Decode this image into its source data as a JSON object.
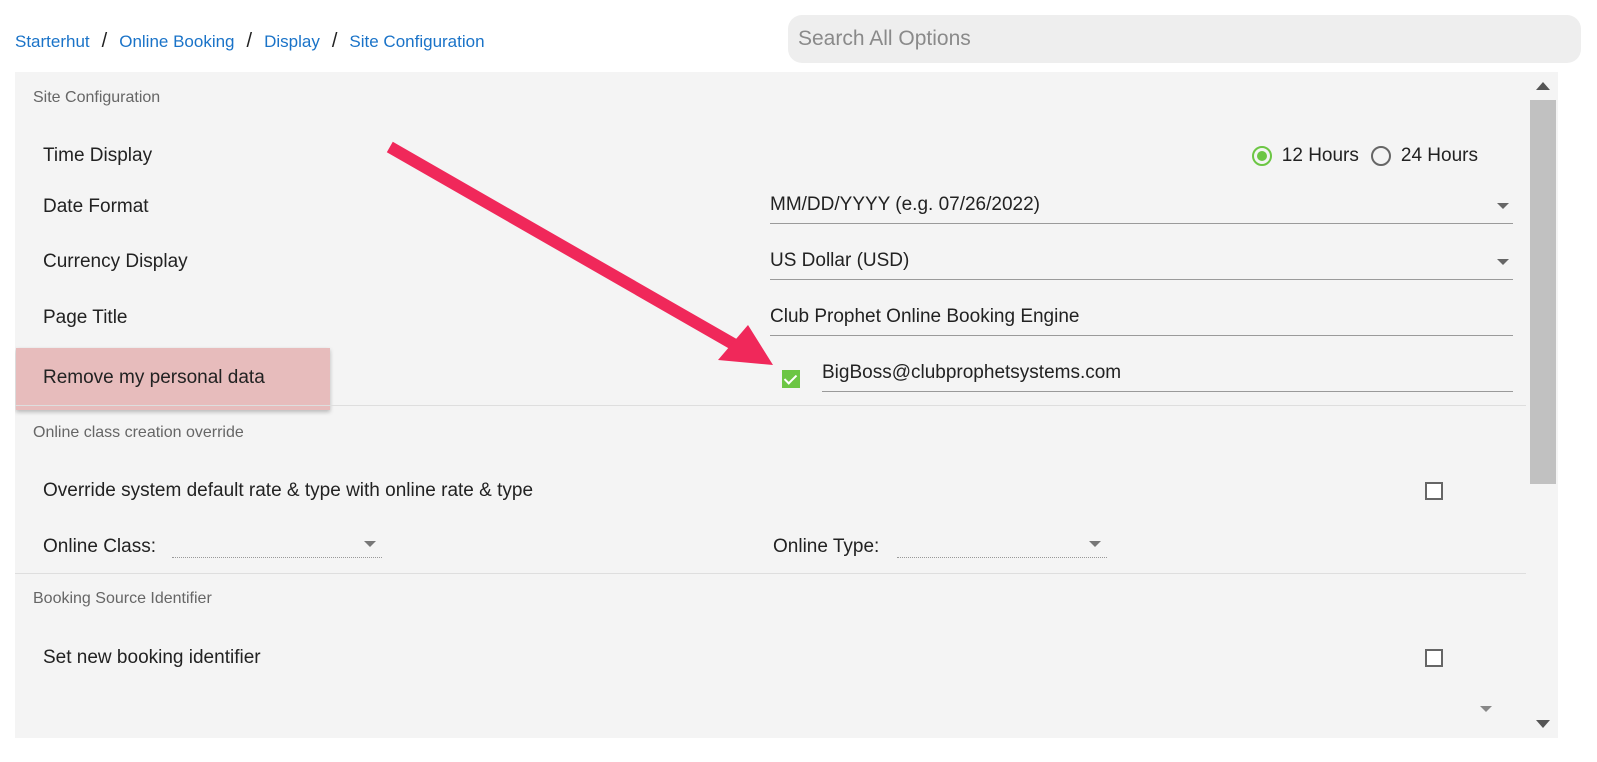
{
  "breadcrumb": {
    "items": [
      "Starterhut",
      "Online Booking",
      "Display",
      "Site Configuration"
    ],
    "separator": "/"
  },
  "search": {
    "placeholder": "Search All Options"
  },
  "site_configuration": {
    "title": "Site Configuration",
    "time_display": {
      "label": "Time Display",
      "options": [
        "12 Hours",
        "24 Hours"
      ],
      "selected": "12 Hours"
    },
    "date_format": {
      "label": "Date Format",
      "value": "MM/DD/YYYY (e.g. 07/26/2022)"
    },
    "currency_display": {
      "label": "Currency Display",
      "value": "US Dollar (USD)"
    },
    "page_title": {
      "label": "Page Title",
      "value": "Club Prophet Online Booking Engine"
    },
    "remove_personal_data": {
      "label": "Remove my personal data",
      "checked": true,
      "email": "BigBoss@clubprophetsystems.com"
    }
  },
  "online_class_override": {
    "title": "Online class creation override",
    "override_label": "Override system default rate & type with online rate & type",
    "override_checked": false,
    "online_class_label": "Online Class:",
    "online_type_label": "Online Type:"
  },
  "booking_source": {
    "title": "Booking Source Identifier",
    "set_identifier_label": "Set new booking identifier",
    "set_identifier_checked": false
  },
  "colors": {
    "accent": "#6cc644",
    "link": "#1a73c8",
    "annotation_arrow": "#f0285a",
    "highlight": "#dd9696"
  }
}
